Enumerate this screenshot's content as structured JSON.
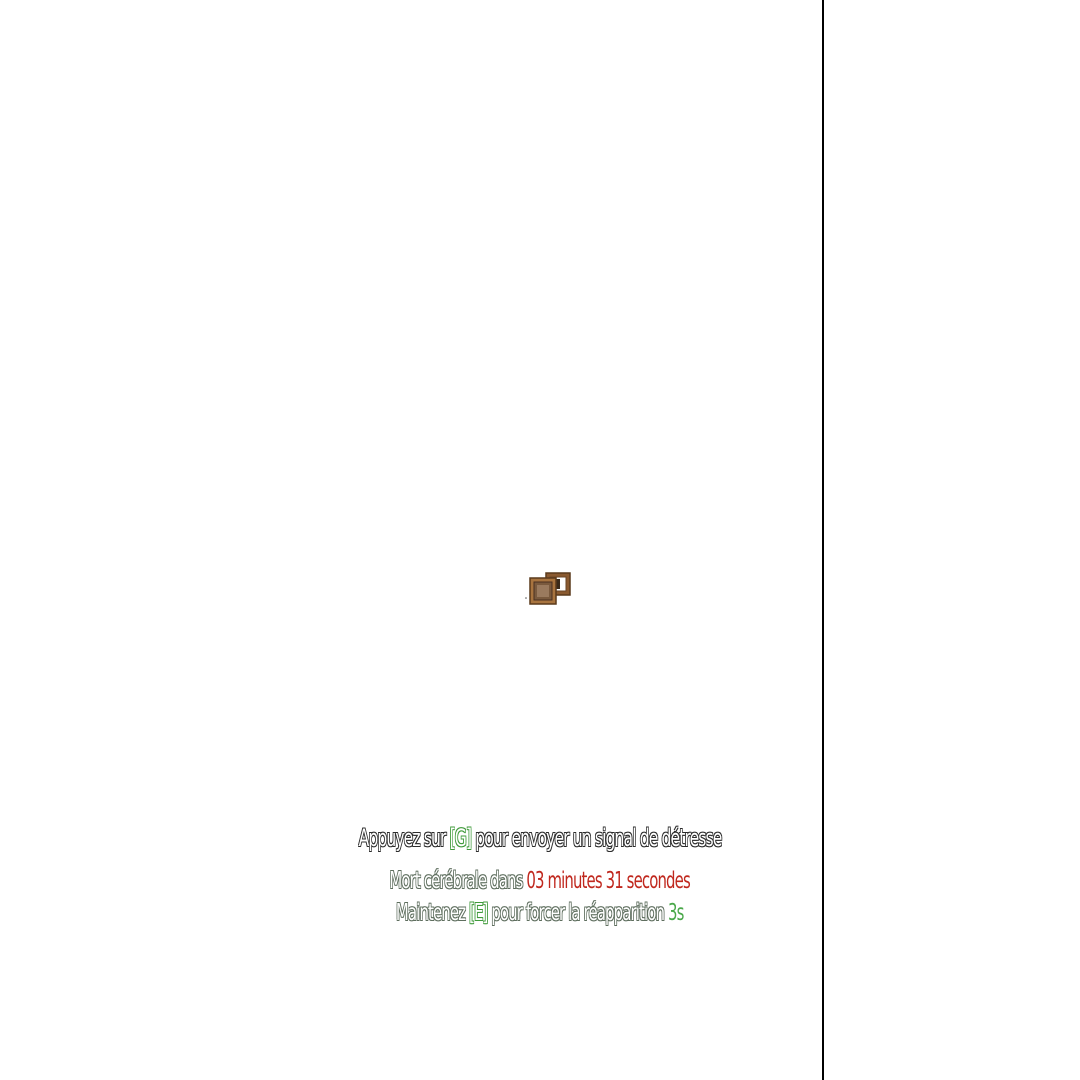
{
  "hud": {
    "distress": {
      "before": "Appuyez sur ",
      "key": "[G]",
      "after": " pour envoyer un signal de détresse"
    },
    "brain_death": {
      "label": "Mort cérébrale dans ",
      "timer": "03 minutes 31 secondes"
    },
    "respawn": {
      "before": "Maintenez ",
      "key": "[E]",
      "middle": " pour forcer la réapparition ",
      "countdown": "3s"
    }
  },
  "icons": {
    "crate": "crate-icon"
  },
  "colors": {
    "key_green": "#3f9a3a",
    "timer_red": "#c0281e",
    "countdown_green": "#4aa84a",
    "crate_brown": "#9a6a3c",
    "edge_line": "#000000"
  }
}
